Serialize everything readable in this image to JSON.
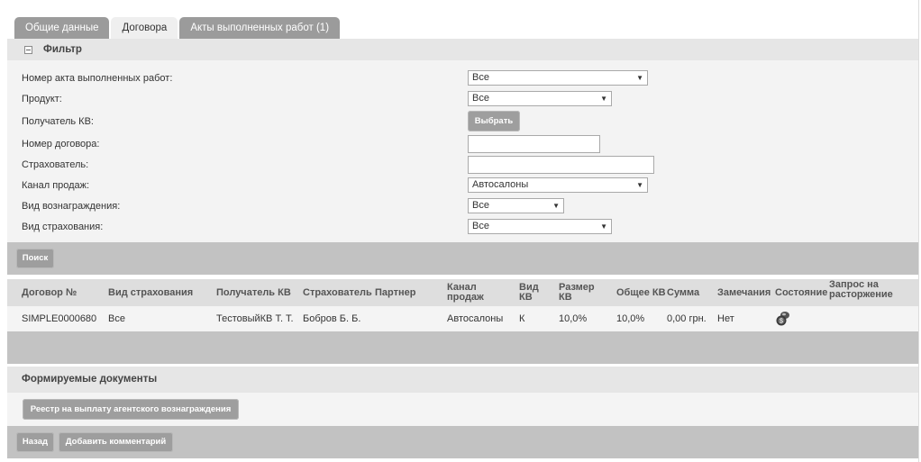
{
  "tabs": [
    {
      "label": "Общие данные",
      "active": false
    },
    {
      "label": "Договора",
      "active": true
    },
    {
      "label": "Акты выполненных работ (1)",
      "active": false
    }
  ],
  "filter": {
    "title": "Фильтр",
    "fields": {
      "act_number": {
        "label": "Номер акта выполненных работ:",
        "value": "Все"
      },
      "product": {
        "label": "Продукт:",
        "value": "Все"
      },
      "recipient": {
        "label": "Получатель КВ:",
        "button": "Выбрать"
      },
      "contract_number": {
        "label": "Номер договора:",
        "value": ""
      },
      "insurer": {
        "label": "Страхователь:",
        "value": ""
      },
      "sales_channel": {
        "label": "Канал продаж:",
        "value": "Автосалоны"
      },
      "reward_type": {
        "label": "Вид вознаграждения:",
        "value": "Все"
      },
      "insurance_type": {
        "label": "Вид страхования:",
        "value": "Все"
      }
    },
    "search_button": "Поиск"
  },
  "table": {
    "columns": {
      "contract": "Договор №",
      "insurance_type": "Вид страхования",
      "recipient": "Получатель КВ",
      "insurer": "Страхователь",
      "partner": "Партнер",
      "channel": "Канал продаж",
      "kv_type": "Вид КВ",
      "kv_size": "Размер КВ",
      "total_kv": "Общее КВ",
      "sum": "Сумма",
      "remarks": "Замечания",
      "status": "Состояние",
      "termination_request": "Запрос на расторжение"
    },
    "rows": [
      {
        "contract": "SIMPLE0000680",
        "insurance_type": "Все",
        "recipient": "ТестовыйКВ Т. Т.",
        "insurer": "Бобров Б. Б.",
        "partner": "",
        "channel": "Автосалоны",
        "kv_type": "К",
        "kv_size": "10,0%",
        "total_kv": "10,0%",
        "sum": "0,00 грн.",
        "remarks": "Нет",
        "status_icon": "money-bag-icon"
      }
    ]
  },
  "documents": {
    "title": "Формируемые документы",
    "registry_button": "Реестр на выплату агентского вознаграждения"
  },
  "footer": {
    "back_button": "Назад",
    "comment_button": "Добавить комментарий"
  }
}
